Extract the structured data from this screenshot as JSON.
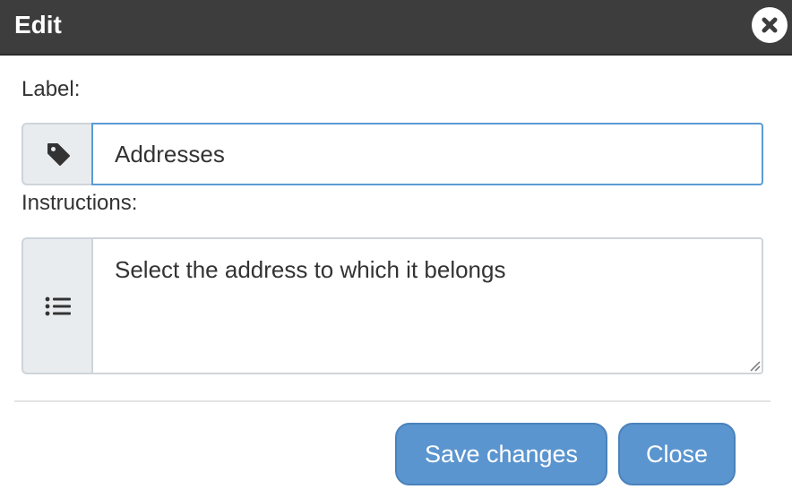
{
  "dialog": {
    "title": "Edit",
    "close_icon": "close-icon"
  },
  "label_field": {
    "label": "Label:",
    "icon": "tag-icon",
    "value": "Addresses"
  },
  "instructions_field": {
    "label": "Instructions:",
    "icon": "list-icon",
    "value": "Select the address to which it belongs"
  },
  "footer": {
    "save_label": "Save changes",
    "close_label": "Close"
  },
  "colors": {
    "titlebar": "#3d3d3d",
    "button": "#5b95cf",
    "focus_border": "#5b9bd5",
    "addon_bg": "#e9ecef"
  }
}
